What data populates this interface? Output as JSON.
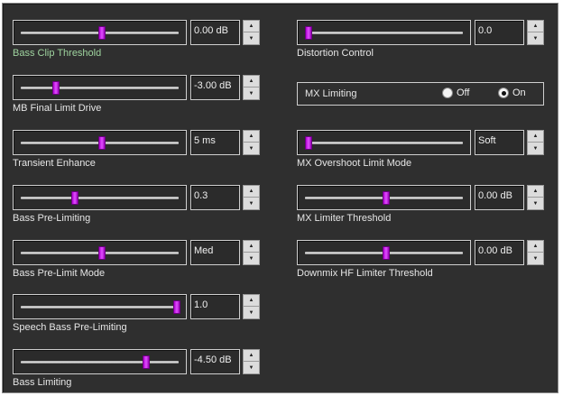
{
  "left_controls": [
    {
      "label": "Bass Clip Threshold",
      "value": "0.00 dB",
      "level": 0.51,
      "highlight": true
    },
    {
      "label": "MB Final Limit Drive",
      "value": "-3.00 dB",
      "level": 0.21,
      "highlight": false
    },
    {
      "label": "Transient Enhance",
      "value": "5 ms",
      "level": 0.51,
      "highlight": false
    },
    {
      "label": "Bass Pre-Limiting",
      "value": "0.3",
      "level": 0.33,
      "highlight": false
    },
    {
      "label": "Bass Pre-Limit Mode",
      "value": "Med",
      "level": 0.51,
      "highlight": false
    },
    {
      "label": "Speech Bass Pre-Limiting",
      "value": "1.0",
      "level": 1.0,
      "highlight": false
    },
    {
      "label": "Bass Limiting",
      "value": "-4.50 dB",
      "level": 0.8,
      "highlight": false
    }
  ],
  "right_controls": [
    {
      "label": "Distortion Control",
      "value": "0.0",
      "level": 0.0,
      "highlight": false
    },
    {
      "label": "MX Overshoot Limit Mode",
      "value": "Soft",
      "level": 0.0,
      "highlight": false
    },
    {
      "label": "MX Limiter Threshold",
      "value": "0.00 dB",
      "level": 0.51,
      "highlight": false
    },
    {
      "label": "Downmix HF Limiter Threshold",
      "value": "0.00 dB",
      "level": 0.51,
      "highlight": false
    }
  ],
  "mx_limiting": {
    "label": "MX Limiting",
    "options": [
      "Off",
      "On"
    ],
    "selected": "On"
  },
  "spin_icons": {
    "up": "up-arrow-icon",
    "down": "down-arrow-icon"
  },
  "colors": {
    "thumb": "#d020f0",
    "label_highlight": "#9fd49f",
    "panel": "#2f2f2f"
  }
}
